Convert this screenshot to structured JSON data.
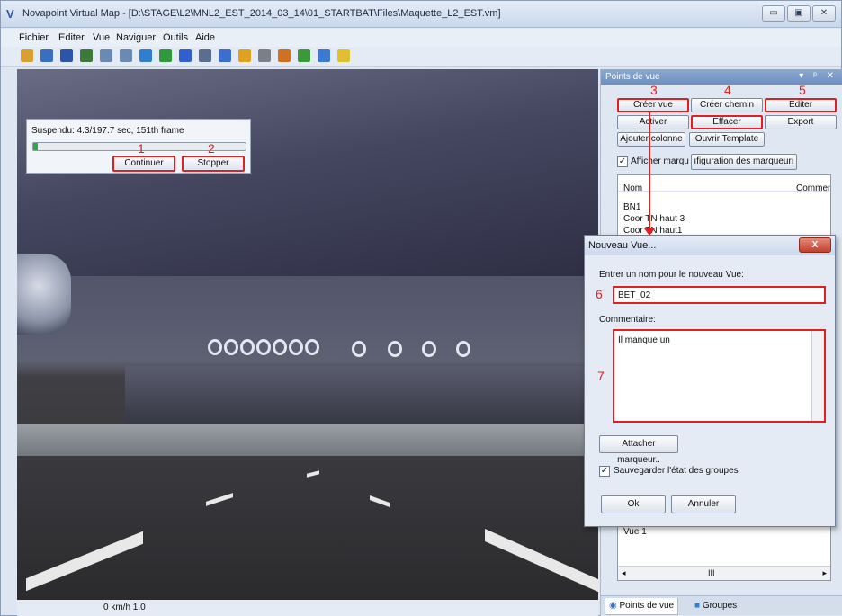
{
  "window": {
    "title": "Novapoint Virtual Map - [D:\\STAGE\\L2\\MNL2_EST_2014_03_14\\01_STARTBAT\\Files\\Maquette_L2_EST.vm]",
    "app_icon": "V",
    "minimize_icon": "minimize-icon",
    "maximize_icon": "maximize-icon",
    "close_icon": "close-icon"
  },
  "menu": [
    "Fichier",
    "Editer",
    "Vue",
    "Naviguer",
    "Outils",
    "Aide"
  ],
  "toolbar": {
    "icons": [
      "open-icon",
      "save-icon",
      "back-icon",
      "walk-icon",
      "fly-icon",
      "orbit-icon",
      "select-icon",
      "move-icon",
      "view-icon",
      "search-icon",
      "globe-icon",
      "measure-icon",
      "draw-icon",
      "marker-icon",
      "paint-icon",
      "ruler-icon",
      "settings-icon"
    ],
    "colors": [
      "#d9a030",
      "#3a6fbf",
      "#2a55a8",
      "#3c7a3c",
      "#6a8ab4",
      "#6a8ab4",
      "#2f7fd1",
      "#2f9a3a",
      "#2f5fd1",
      "#5a6f90",
      "#3a6fd1",
      "#e0a020",
      "#7a7f88",
      "#d07020",
      "#3a9a3a",
      "#3a7ad1",
      "#e0c030",
      "#2a6fd1"
    ]
  },
  "playback": {
    "status": "Suspendu: 4.3/197.7 sec, 151th frame",
    "progress_fraction": 0.022,
    "continue_label": "Continuer",
    "stop_label": "Stopper",
    "continue_num": "1",
    "stop_num": "2"
  },
  "status_bar": {
    "speed": "0 km/h 1.0"
  },
  "panel": {
    "title": "Points de vue",
    "head_icons": "▾ ᵖ ✕",
    "buttons": {
      "creer_vue": "Créer vue",
      "creer_chemin": "Créer chemin",
      "editer": "Editer",
      "activer": "Activer",
      "effacer": "Effacer",
      "export": "Export",
      "ajouter_colonne": "Ajouter colonne",
      "ouvrir_template": "Ouvrir Template",
      "config_marqueurs": "ıfiguration des marqueurı"
    },
    "nums": {
      "creer_vue": "3",
      "creer_chemin": "4",
      "editer": "5"
    },
    "afficher_label": "Afficher marqu",
    "afficher_checked": "✓",
    "list": {
      "col_nom": "Nom",
      "col_comment": "Commen",
      "items": [
        "BN1",
        "Coor TN haut 3",
        "Coor TN haut1"
      ],
      "bottom_item": "Vue 1",
      "scroll_left": "◂",
      "scroll_thumb": "III",
      "scroll_right": "▸"
    },
    "tabs": {
      "points_de_vue": "Points de vue",
      "groupes": "Groupes"
    }
  },
  "dialog": {
    "title": "Nouveau Vue...",
    "close_label": "X",
    "name_label": "Entrer un nom pour le nouveau Vue:",
    "name_value": "BET_02",
    "name_num": "6",
    "comment_label": "Commentaire:",
    "comment_value": "Il manque un",
    "comment_num": "7",
    "attach_button": "Attacher marqueur..",
    "save_groups_label": "Sauvegarder l'état des groupes",
    "save_groups_checked": "✓",
    "ok_label": "Ok",
    "cancel_label": "Annuler"
  },
  "accent": {
    "annotation_red": "#e02020",
    "progress_green": "#2ea84a"
  }
}
